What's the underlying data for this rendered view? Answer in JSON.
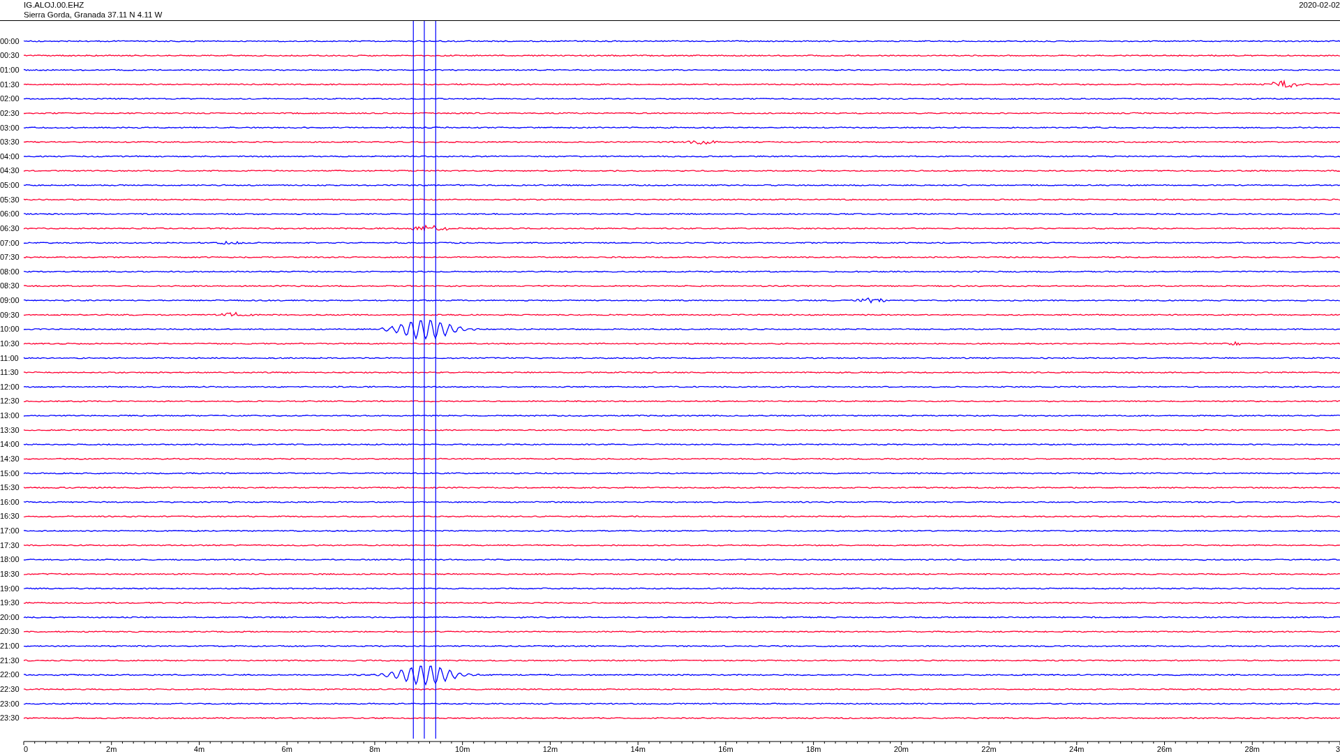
{
  "header": {
    "channel": "IG.ALOJ.00.EHZ",
    "station": "Sierra Gorda, Granada  37.11 N 4.11 W",
    "date": "2020-02-02"
  },
  "rows": [
    {
      "label": "00:00",
      "color": "#0000ff"
    },
    {
      "label": "00:30",
      "color": "#ff0033"
    },
    {
      "label": "01:00",
      "color": "#0000ff"
    },
    {
      "label": "01:30",
      "color": "#ff0033"
    },
    {
      "label": "02:00",
      "color": "#0000ff"
    },
    {
      "label": "02:30",
      "color": "#ff0033"
    },
    {
      "label": "03:00",
      "color": "#0000ff"
    },
    {
      "label": "03:30",
      "color": "#ff0033"
    },
    {
      "label": "04:00",
      "color": "#0000ff"
    },
    {
      "label": "04:30",
      "color": "#ff0033"
    },
    {
      "label": "05:00",
      "color": "#0000ff"
    },
    {
      "label": "05:30",
      "color": "#ff0033"
    },
    {
      "label": "06:00",
      "color": "#0000ff"
    },
    {
      "label": "06:30",
      "color": "#ff0033"
    },
    {
      "label": "07:00",
      "color": "#0000ff"
    },
    {
      "label": "07:30",
      "color": "#ff0033"
    },
    {
      "label": "08:00",
      "color": "#0000ff"
    },
    {
      "label": "08:30",
      "color": "#ff0033"
    },
    {
      "label": "09:00",
      "color": "#0000ff"
    },
    {
      "label": "09:30",
      "color": "#ff0033"
    },
    {
      "label": "10:00",
      "color": "#0000ff"
    },
    {
      "label": "10:30",
      "color": "#ff0033"
    },
    {
      "label": "11:00",
      "color": "#0000ff"
    },
    {
      "label": "11:30",
      "color": "#ff0033"
    },
    {
      "label": "12:00",
      "color": "#0000ff"
    },
    {
      "label": "12:30",
      "color": "#ff0033"
    },
    {
      "label": "13:00",
      "color": "#0000ff"
    },
    {
      "label": "13:30",
      "color": "#ff0033"
    },
    {
      "label": "14:00",
      "color": "#0000ff"
    },
    {
      "label": "14:30",
      "color": "#ff0033"
    },
    {
      "label": "15:00",
      "color": "#0000ff"
    },
    {
      "label": "15:30",
      "color": "#ff0033"
    },
    {
      "label": "16:00",
      "color": "#0000ff"
    },
    {
      "label": "16:30",
      "color": "#ff0033"
    },
    {
      "label": "17:00",
      "color": "#0000ff"
    },
    {
      "label": "17:30",
      "color": "#ff0033"
    },
    {
      "label": "18:00",
      "color": "#0000ff"
    },
    {
      "label": "18:30",
      "color": "#ff0033"
    },
    {
      "label": "19:00",
      "color": "#0000ff"
    },
    {
      "label": "19:30",
      "color": "#ff0033"
    },
    {
      "label": "20:00",
      "color": "#0000ff"
    },
    {
      "label": "20:30",
      "color": "#ff0033"
    },
    {
      "label": "21:00",
      "color": "#0000ff"
    },
    {
      "label": "21:30",
      "color": "#ff0033"
    },
    {
      "label": "22:00",
      "color": "#0000ff"
    },
    {
      "label": "22:30",
      "color": "#ff0033"
    },
    {
      "label": "23:00",
      "color": "#0000ff"
    },
    {
      "label": "23:30",
      "color": "#ff0033"
    }
  ],
  "axis": {
    "ticks": [
      "0",
      "2m",
      "4m",
      "6m",
      "8m",
      "10m",
      "12m",
      "14m",
      "16m",
      "18m",
      "20m",
      "22m",
      "24m",
      "26m",
      "28m",
      "3"
    ]
  }
}
